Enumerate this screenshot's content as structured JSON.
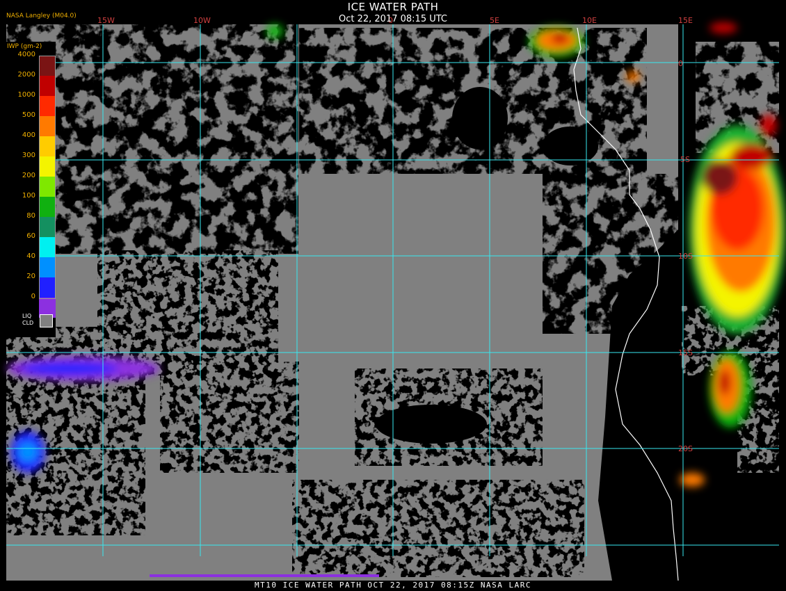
{
  "title": "ICE WATER PATH",
  "subtitle": "Oct 22, 2017 08:15 UTC",
  "credit": "NASA Langley (M04.0)",
  "footer": "MT10  ICE WATER PATH  OCT 22, 2017 08:15Z  NASA LARC",
  "colors": {
    "grid": "#38e8f0",
    "coast": "#ffffff",
    "liquid_cloud": "#808080",
    "clear": "#000000",
    "label": "#d04040"
  },
  "legend": {
    "title": "IWP (gm-2)",
    "levels": [
      {
        "label": "4000",
        "color": "#7a1414"
      },
      {
        "label": "2000",
        "color": "#c00000"
      },
      {
        "label": "1000",
        "color": "#ff2a00"
      },
      {
        "label": "500",
        "color": "#ff7a00"
      },
      {
        "label": "400",
        "color": "#ffcc00"
      },
      {
        "label": "300",
        "color": "#f4f400"
      },
      {
        "label": "200",
        "color": "#7fe800"
      },
      {
        "label": "100",
        "color": "#10b010"
      },
      {
        "label": "80",
        "color": "#149060"
      },
      {
        "label": "60",
        "color": "#00f0f0"
      },
      {
        "label": "40",
        "color": "#0090ff"
      },
      {
        "label": "20",
        "color": "#2020ff"
      },
      {
        "label": "0",
        "color": "#8c30e0"
      }
    ],
    "liq_label_1": "LIQ",
    "liq_label_2": "CLD"
  },
  "grid_labels": {
    "lon": [
      "15W",
      "10W",
      "0",
      "5E",
      "10E",
      "15E"
    ],
    "lat": [
      "0",
      "5S",
      "10S",
      "15S",
      "20S"
    ]
  }
}
